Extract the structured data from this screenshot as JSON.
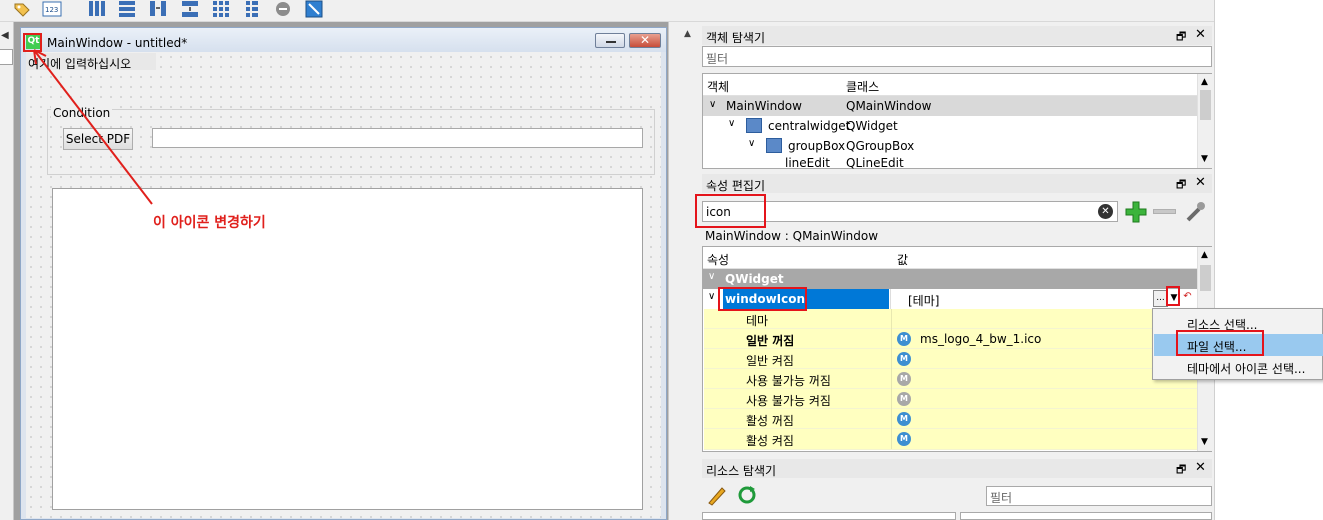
{
  "toolbar": {
    "icons": [
      "tag-icon",
      "number-123-icon",
      "layout-horizontal-icon",
      "layout-vertical-icon",
      "layout-horizontal-splitter-icon",
      "layout-vertical-splitter-icon",
      "layout-grid-icon",
      "layout-form-icon",
      "break-layout-icon",
      "adjust-size-icon"
    ]
  },
  "form_window": {
    "title": "MainWindow - untitled*",
    "qt_badge": "Qt",
    "menu_placeholder": "여기에 입력하십시오",
    "group_title": "Condition",
    "select_pdf_label": "Select PDF",
    "pdf_path_value": ""
  },
  "annotation": {
    "text": "이 아이콘 변경하기",
    "color": "#e0201c"
  },
  "object_inspector": {
    "title": "객체 탐색기",
    "filter_placeholder": "필터",
    "columns": [
      "객체",
      "클래스"
    ],
    "rows": [
      {
        "object": "MainWindow",
        "class": "QMainWindow"
      },
      {
        "object": "centralwidget",
        "class": "QWidget"
      },
      {
        "object": "groupBox",
        "class": "QGroupBox"
      },
      {
        "object": "lineEdit",
        "class": "QLineEdit"
      }
    ]
  },
  "property_editor": {
    "title": "속성 편집기",
    "search_value": "icon",
    "context": "MainWindow : QMainWindow",
    "columns": [
      "속성",
      "값"
    ],
    "group": "QWidget",
    "selected_property": "windowIcon",
    "selected_value": "[테마]",
    "more_button": "...",
    "sub_properties": [
      {
        "name": "테마",
        "bold": false,
        "icon": "",
        "value": ""
      },
      {
        "name": "일반 꺼짐",
        "bold": true,
        "icon": "blue",
        "value": "ms_logo_4_bw_1.ico"
      },
      {
        "name": "일반 켜짐",
        "bold": false,
        "icon": "blue",
        "value": ""
      },
      {
        "name": "사용 불가능 꺼짐",
        "bold": false,
        "icon": "gray",
        "value": ""
      },
      {
        "name": "사용 불가능 켜짐",
        "bold": false,
        "icon": "gray",
        "value": ""
      },
      {
        "name": "활성 꺼짐",
        "bold": false,
        "icon": "blue",
        "value": ""
      },
      {
        "name": "활성 켜짐",
        "bold": false,
        "icon": "blue",
        "value": ""
      }
    ]
  },
  "popup_menu": {
    "items": [
      "리소스 선택...",
      "파일 선택...",
      "테마에서 아이콘 선택..."
    ],
    "highlighted": "파일 선택..."
  },
  "resource_browser": {
    "title": "리소스 탐색기",
    "filter_placeholder": "필터"
  },
  "colors": {
    "accent_selection": "#0078d7",
    "property_yellow": "#ffffc0",
    "group_header": "#a8a8a8",
    "highlight_red": "#e4141b",
    "menu_highlight": "#99c9ef"
  }
}
